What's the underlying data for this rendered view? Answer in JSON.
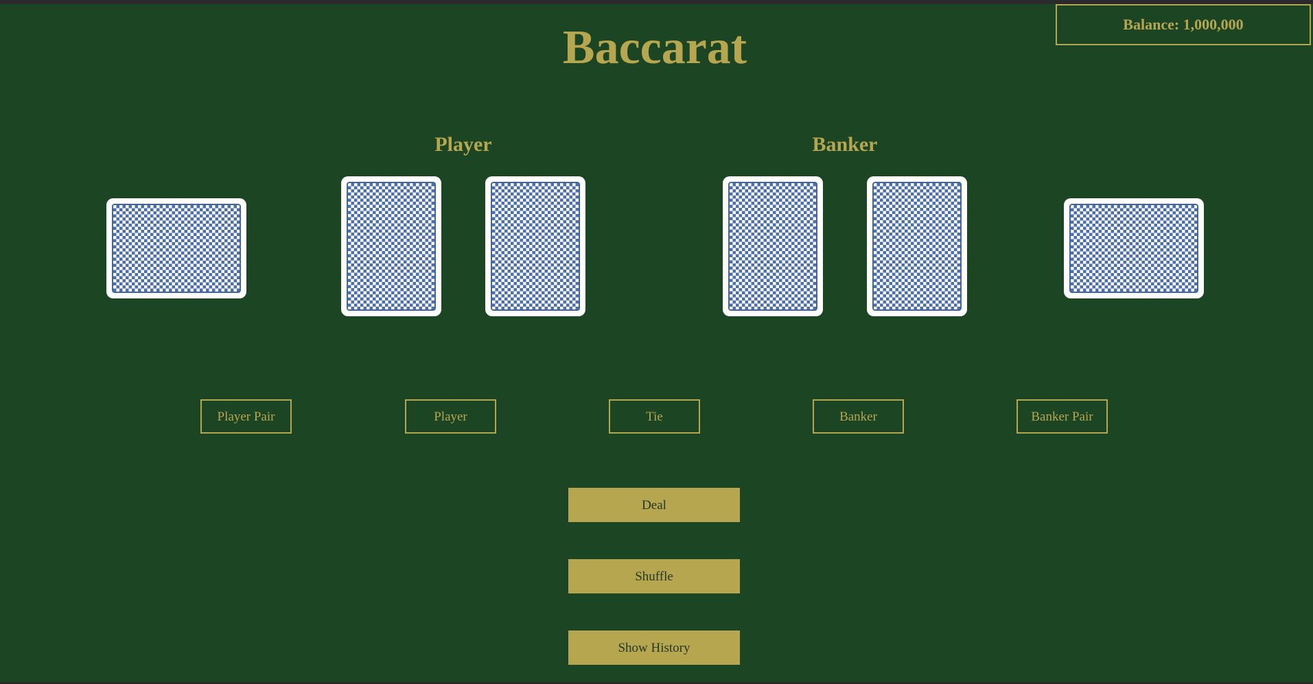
{
  "title": "Baccarat",
  "balance": {
    "label": "Balance: 1,000,000"
  },
  "player": {
    "label": "Player",
    "cards": [
      "card-back",
      "card-back",
      "card-back"
    ]
  },
  "banker": {
    "label": "Banker",
    "cards": [
      "card-back",
      "card-back",
      "card-back"
    ]
  },
  "bets": [
    {
      "label": "Player Pair"
    },
    {
      "label": "Player"
    },
    {
      "label": "Tie"
    },
    {
      "label": "Banker"
    },
    {
      "label": "Banker Pair"
    }
  ],
  "actions": {
    "deal": "Deal",
    "shuffle": "Shuffle",
    "history": "Show History"
  },
  "colors": {
    "felt": "#1c4524",
    "gold": "#b6a650",
    "card_back_pattern": "#4b6fae",
    "button_text": "#24381f"
  }
}
